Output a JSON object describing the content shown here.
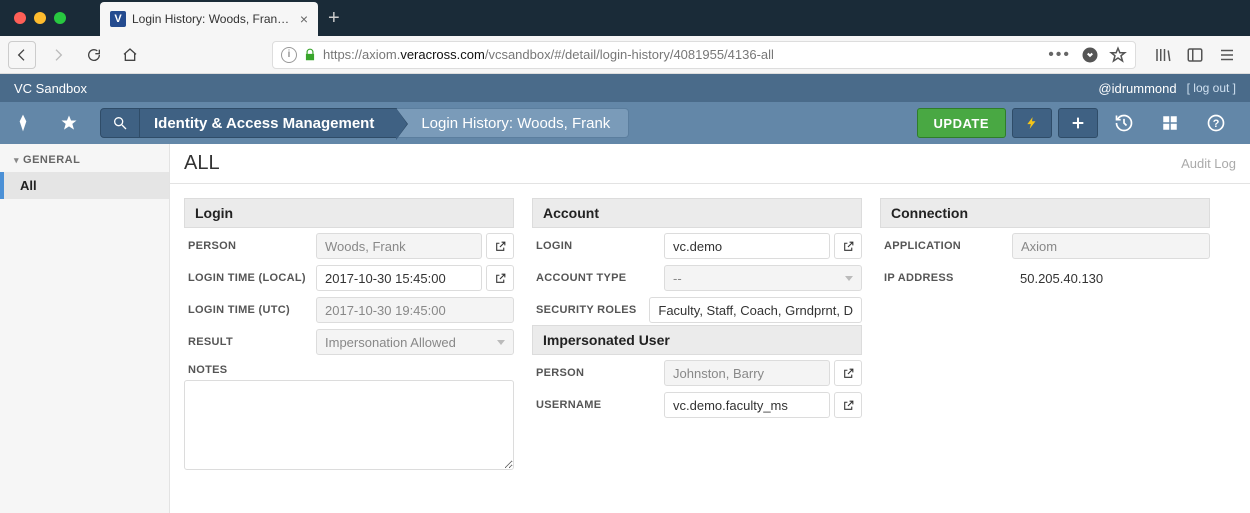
{
  "browser": {
    "tab_title": "Login History: Woods, Frank - A",
    "favicon_letter": "V",
    "url_prefix": "https://axiom.",
    "url_domain": "veracross.com",
    "url_path": "/vcsandbox/#/detail/login-history/4081955/4136-all"
  },
  "appbar": {
    "title": "VC Sandbox",
    "user": "@idrummond",
    "logout": "[ log out ]"
  },
  "toolbar": {
    "breadcrumb1": "Identity & Access Management",
    "breadcrumb2": "Login History: Woods, Frank",
    "update": "UPDATE"
  },
  "sidebar": {
    "section": "GENERAL",
    "items": [
      {
        "label": "All",
        "active": true
      }
    ]
  },
  "main": {
    "heading": "ALL",
    "auditlog": "Audit Log"
  },
  "login": {
    "title": "Login",
    "person_label": "PERSON",
    "person_value": "Woods, Frank",
    "login_local_label": "LOGIN TIME (LOCAL)",
    "login_local_value": "2017-10-30 15:45:00",
    "login_utc_label": "LOGIN TIME (UTC)",
    "login_utc_value": "2017-10-30 19:45:00",
    "result_label": "RESULT",
    "result_value": "Impersonation Allowed",
    "notes_label": "NOTES",
    "notes_value": ""
  },
  "account": {
    "title": "Account",
    "login_label": "LOGIN",
    "login_value": "vc.demo",
    "type_label": "ACCOUNT TYPE",
    "type_value": "--",
    "roles_label": "SECURITY ROLES",
    "roles_value": "Faculty, Staff, Coach, Grndprnt, D"
  },
  "impersonated": {
    "title": "Impersonated User",
    "person_label": "PERSON",
    "person_value": "Johnston, Barry",
    "username_label": "USERNAME",
    "username_value": "vc.demo.faculty_ms"
  },
  "connection": {
    "title": "Connection",
    "app_label": "APPLICATION",
    "app_value": "Axiom",
    "ip_label": "IP ADDRESS",
    "ip_value": "50.205.40.130"
  }
}
